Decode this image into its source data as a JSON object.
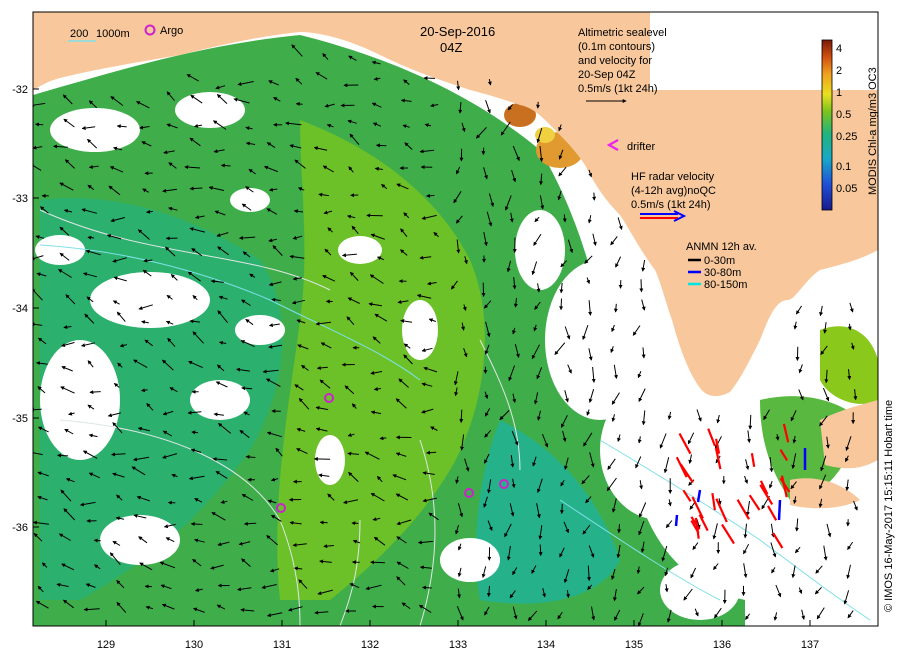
{
  "map": {
    "date": "20-Sep-2016",
    "time": "04Z",
    "bathy_legend": {
      "contour_200": "200",
      "contour_1000": "1000m"
    },
    "argo_legend": "Argo",
    "altimetry_note": [
      "Altimetric sealevel",
      "(0.1m contours)",
      "and velocity for",
      "20-Sep 04Z",
      "0.5m/s (1kt 24h)"
    ],
    "drifter_label": "drifter",
    "hf_radar_note": [
      "HF radar velocity",
      "(4-12h avg)noQC",
      "0.5m/s (1kt 24h)"
    ],
    "anmn_legend": {
      "title": "ANMN 12h av.",
      "items": [
        {
          "label": "0-30m",
          "color": "#000000"
        },
        {
          "label": "30-80m",
          "color": "#0000ff"
        },
        {
          "label": "80-150m",
          "color": "#00e5e5"
        }
      ]
    },
    "colorbar": {
      "title": "MODIS Chl-a mg/m3 OC3",
      "ticks": [
        "4",
        "2",
        "1",
        "0.5",
        "0.25",
        "0.1",
        "0.05"
      ]
    },
    "credit": "© IMOS 16-May-2017 15:15:11 Hobart time",
    "x_ticks": [
      "129",
      "130",
      "131",
      "132",
      "133",
      "134",
      "135",
      "136",
      "137"
    ],
    "y_ticks": [
      "-32",
      "-33",
      "-34",
      "-35",
      "-36"
    ],
    "argo_floats": [
      {
        "lon": 131.5,
        "lat": -34.8
      },
      {
        "lon": 130.95,
        "lat": -35.8
      },
      {
        "lon": 133.05,
        "lat": -35.65
      },
      {
        "lon": 133.4,
        "lat": -35.55
      }
    ],
    "colors": {
      "land": "#f8c89c",
      "chl_low": "#22b47c",
      "chl_mid": "#4fb23a",
      "chl_high": "#7cc41c",
      "argo": "#cc22cc",
      "hf_radar": "#ff0000"
    }
  }
}
